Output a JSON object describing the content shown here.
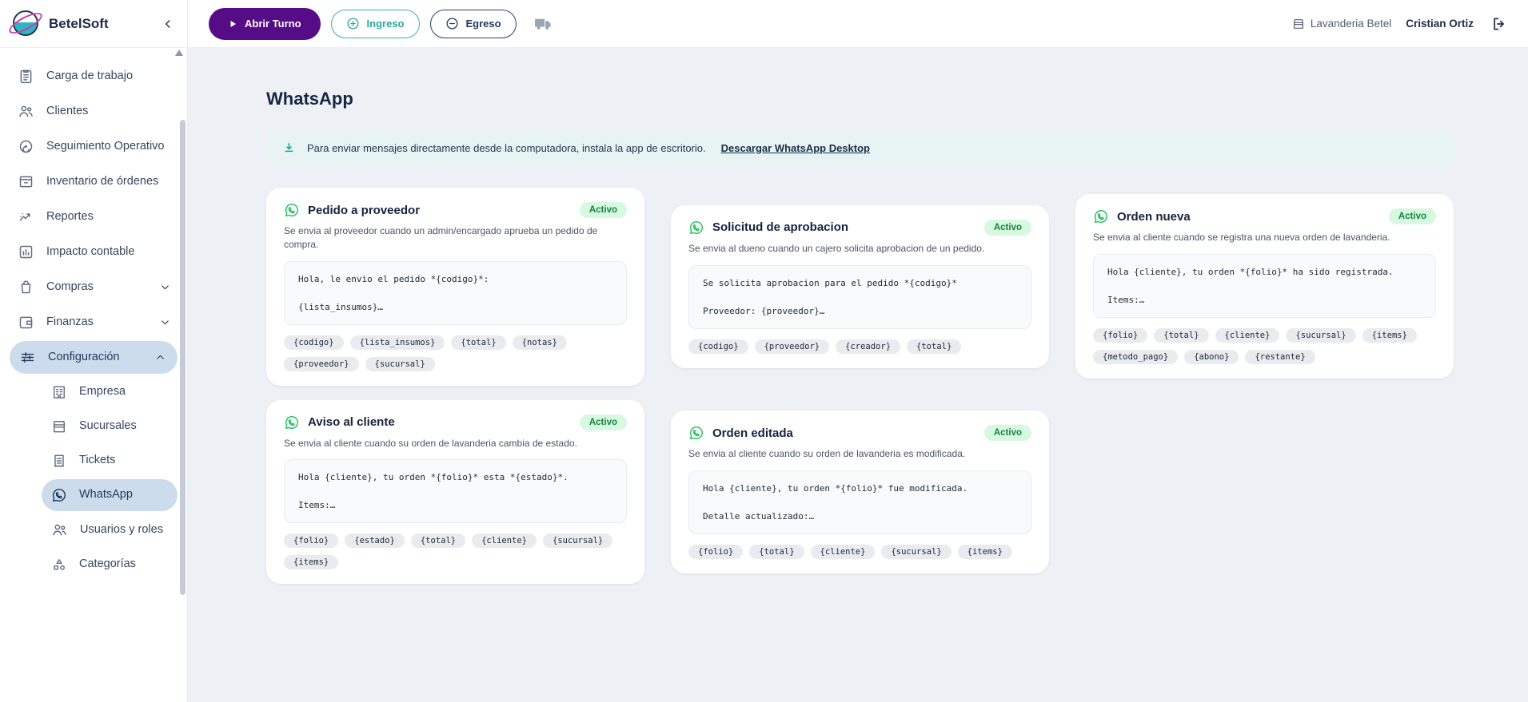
{
  "app": {
    "name": "BetelSoft"
  },
  "topbar": {
    "open_shift_label": "Abrir Turno",
    "income_label": "Ingreso",
    "expense_label": "Egreso",
    "branch": "Lavanderia Betel",
    "user": "Cristian Ortiz"
  },
  "sidebar": {
    "items": [
      {
        "id": "carga-de-trabajo",
        "label": "Carga de trabajo",
        "icon": "clipboard-icon"
      },
      {
        "id": "clientes",
        "label": "Clientes",
        "icon": "users-icon"
      },
      {
        "id": "seguimiento-operativo",
        "label": "Seguimiento Operativo",
        "icon": "gauge-icon"
      },
      {
        "id": "inventario-de-ordenes",
        "label": "Inventario de órdenes",
        "icon": "box-icon"
      },
      {
        "id": "reportes",
        "label": "Reportes",
        "icon": "trend-icon"
      },
      {
        "id": "impacto-contable",
        "label": "Impacto contable",
        "icon": "bar-chart-icon"
      },
      {
        "id": "compras",
        "label": "Compras",
        "icon": "bag-icon",
        "chevron": "down"
      },
      {
        "id": "finanzas",
        "label": "Finanzas",
        "icon": "wallet-icon",
        "chevron": "down"
      },
      {
        "id": "configuracion",
        "label": "Configuración",
        "icon": "sliders-icon",
        "chevron": "up",
        "active": true
      },
      {
        "id": "empresa",
        "label": "Empresa",
        "icon": "building-icon",
        "sub": true
      },
      {
        "id": "sucursales",
        "label": "Sucursales",
        "icon": "store-icon",
        "sub": true
      },
      {
        "id": "tickets",
        "label": "Tickets",
        "icon": "ticket-icon",
        "sub": true
      },
      {
        "id": "whatsapp",
        "label": "WhatsApp",
        "icon": "whatsapp-icon",
        "sub": true,
        "active": true
      },
      {
        "id": "usuarios-y-roles",
        "label": "Usuarios y roles",
        "icon": "users-icon",
        "sub": true
      },
      {
        "id": "categorias",
        "label": "Categorías",
        "icon": "shapes-icon",
        "sub": true
      }
    ]
  },
  "main": {
    "title": "WhatsApp",
    "banner": {
      "text": "Para enviar mensajes directamente desde la computadora, instala la app de escritorio.",
      "link_label": "Descargar WhatsApp Desktop"
    },
    "cards": [
      {
        "title": "Pedido a proveedor",
        "status": "Activo",
        "description": "Se envia al proveedor cuando un admin/encargado aprueba un pedido de compra.",
        "message_lines": [
          "Hola, le envio el pedido *{codigo}*:",
          "{lista_insumos}…"
        ],
        "placeholders": [
          "{codigo}",
          "{lista_insumos}",
          "{total}",
          "{notas}",
          "{proveedor}",
          "{sucursal}"
        ]
      },
      {
        "title": "Solicitud de aprobacion",
        "status": "Activo",
        "description": "Se envia al dueno cuando un cajero solicita aprobacion de un pedido.",
        "message_lines": [
          "Se solicita aprobacion para el pedido *{codigo}*",
          "Proveedor: {proveedor}…"
        ],
        "placeholders": [
          "{codigo}",
          "{proveedor}",
          "{creador}",
          "{total}"
        ]
      },
      {
        "title": "Orden nueva",
        "status": "Activo",
        "description": "Se envia al cliente cuando se registra una nueva orden de lavanderia.",
        "message_lines": [
          "Hola {cliente}, tu orden *{folio}* ha sido registrada.",
          "Items:…"
        ],
        "placeholders": [
          "{folio}",
          "{total}",
          "{cliente}",
          "{sucursal}",
          "{items}",
          "{metodo_pago}",
          "{abono}",
          "{restante}"
        ]
      },
      {
        "title": "Aviso al cliente",
        "status": "Activo",
        "description": "Se envia al cliente cuando su orden de lavanderia cambia de estado.",
        "message_lines": [
          "Hola {cliente}, tu orden *{folio}* esta *{estado}*.",
          "Items:…"
        ],
        "placeholders": [
          "{folio}",
          "{estado}",
          "{total}",
          "{cliente}",
          "{sucursal}",
          "{items}"
        ]
      },
      {
        "title": "Orden editada",
        "status": "Activo",
        "description": "Se envia al cliente cuando su orden de lavanderia es modificada.",
        "message_lines": [
          "Hola {cliente}, tu orden *{folio}* fue modificada.",
          "Detalle actualizado:…"
        ],
        "placeholders": [
          "{folio}",
          "{total}",
          "{cliente}",
          "{sucursal}",
          "{items}"
        ]
      }
    ]
  },
  "colors": {
    "primary_purple": "#560c87",
    "teal": "#2aa89f",
    "navy": "#1d3a5f",
    "whatsapp_green": "#22c05c",
    "badge_bg": "#d7f8e1",
    "badge_text": "#17813f",
    "active_pill_bg": "#cddcec",
    "banner_bg": "#e8f4f3",
    "page_bg": "#edf1f6"
  }
}
